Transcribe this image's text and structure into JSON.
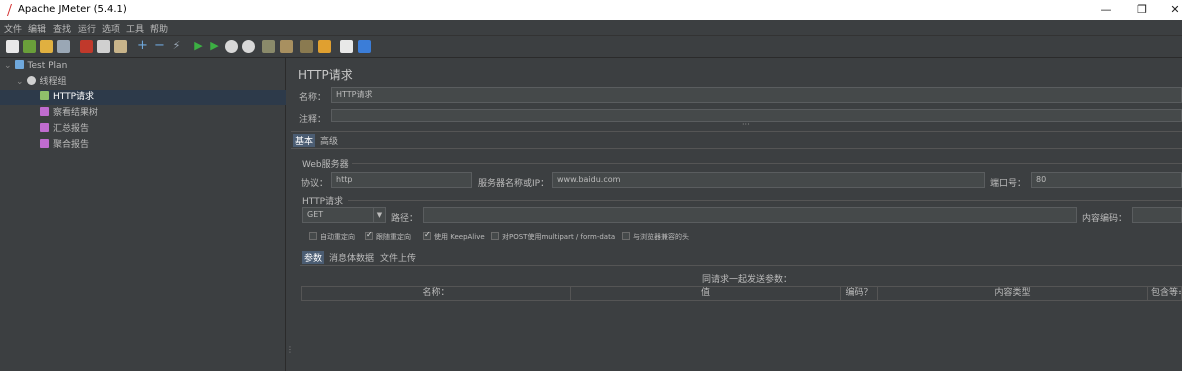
{
  "window": {
    "title": "Apache JMeter (5.4.1)",
    "minimize": "—",
    "maximize": "❐",
    "close": "✕"
  },
  "menu": [
    "文件",
    "编辑",
    "查找",
    "运行",
    "选项",
    "工具",
    "帮助"
  ],
  "toolbar_icons": [
    "new-icon",
    "templates-icon",
    "open-icon",
    "save-icon",
    "cut-icon",
    "copy-icon",
    "paste-icon",
    "expand-icon",
    "collapse-icon",
    "toggle-icon",
    "start-icon",
    "start-no-pause-icon",
    "stop-icon",
    "shutdown-icon",
    "clear-icon",
    "clear-all-icon",
    "search-icon",
    "reset-search-icon",
    "function-helper-icon",
    "help-icon"
  ],
  "tree": {
    "root": "Test Plan",
    "thread_group": "线程组",
    "items": [
      "HTTP请求",
      "察看结果树",
      "汇总报告",
      "聚合报告"
    ]
  },
  "panel": {
    "title": "HTTP请求",
    "name_label": "名称：",
    "name_value": "HTTP请求",
    "comment_label": "注释：",
    "comment_value": "",
    "tabs": [
      "基本",
      "高级"
    ],
    "web_server_label": "Web服务器",
    "protocol_label": "协议：",
    "protocol_value": "http",
    "server_label": "服务器名称或IP：",
    "server_value": "www.baidu.com",
    "port_label": "端口号：",
    "port_value": "80",
    "http_request_label": "HTTP请求",
    "method_value": "GET",
    "path_label": "路径：",
    "path_value": "",
    "encoding_label": "内容编码：",
    "encoding_value": "",
    "checkboxes": [
      {
        "label": "自动重定向",
        "checked": false
      },
      {
        "label": "跟随重定向",
        "checked": true
      },
      {
        "label": "使用 KeepAlive",
        "checked": true
      },
      {
        "label": "对POST使用multipart / form-data",
        "checked": false
      },
      {
        "label": "与浏览器兼容的头",
        "checked": false
      }
    ],
    "subtabs": [
      "参数",
      "消息体数据",
      "文件上传"
    ],
    "params_caption": "同请求一起发送参数：",
    "columns": [
      "名称：",
      "值",
      "编码？",
      "内容类型",
      "包含等="
    ]
  }
}
